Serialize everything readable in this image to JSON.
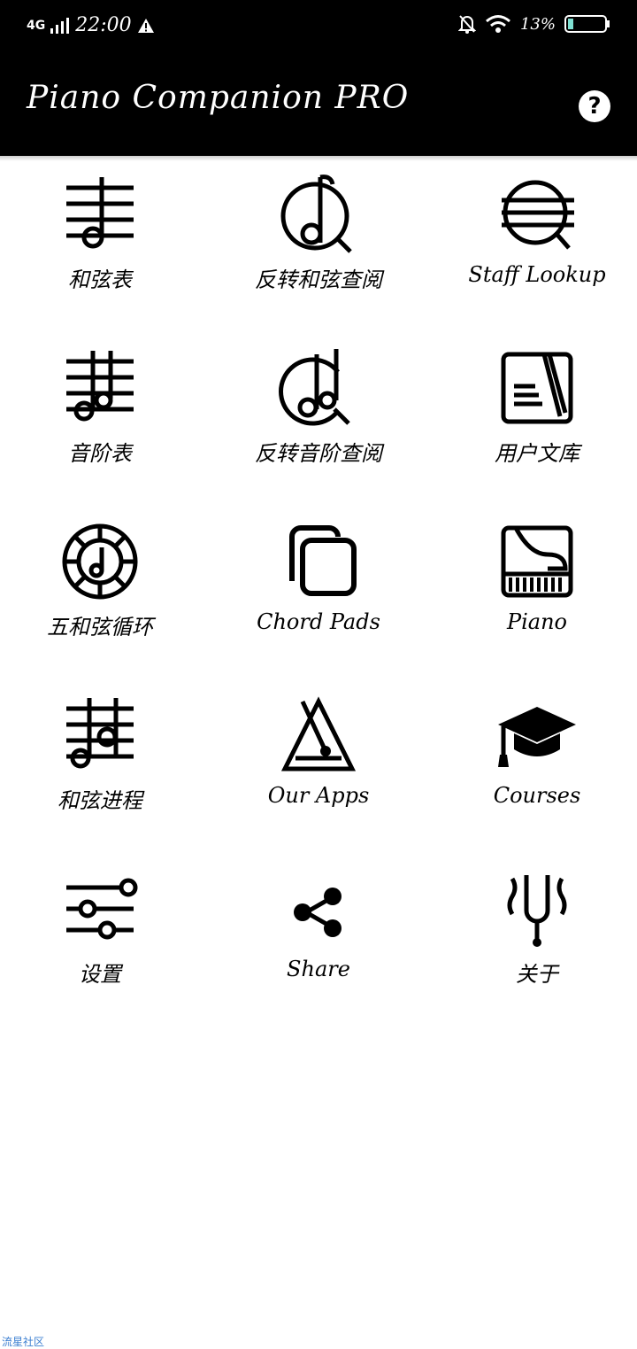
{
  "status": {
    "network": "4G",
    "time": "22:00",
    "battery": "13%"
  },
  "app": {
    "title": "Piano Companion PRO"
  },
  "tiles": [
    {
      "label": "和弦表"
    },
    {
      "label": "反转和弦查阅"
    },
    {
      "label": "Staff Lookup"
    },
    {
      "label": "音阶表"
    },
    {
      "label": "反转音阶查阅"
    },
    {
      "label": "用户文库"
    },
    {
      "label": "五和弦循环"
    },
    {
      "label": "Chord Pads"
    },
    {
      "label": "Piano"
    },
    {
      "label": "和弦进程"
    },
    {
      "label": "Our Apps"
    },
    {
      "label": "Courses"
    },
    {
      "label": "设置"
    },
    {
      "label": "Share"
    },
    {
      "label": "关于"
    }
  ],
  "footer": {
    "watermark": "流星社区"
  }
}
